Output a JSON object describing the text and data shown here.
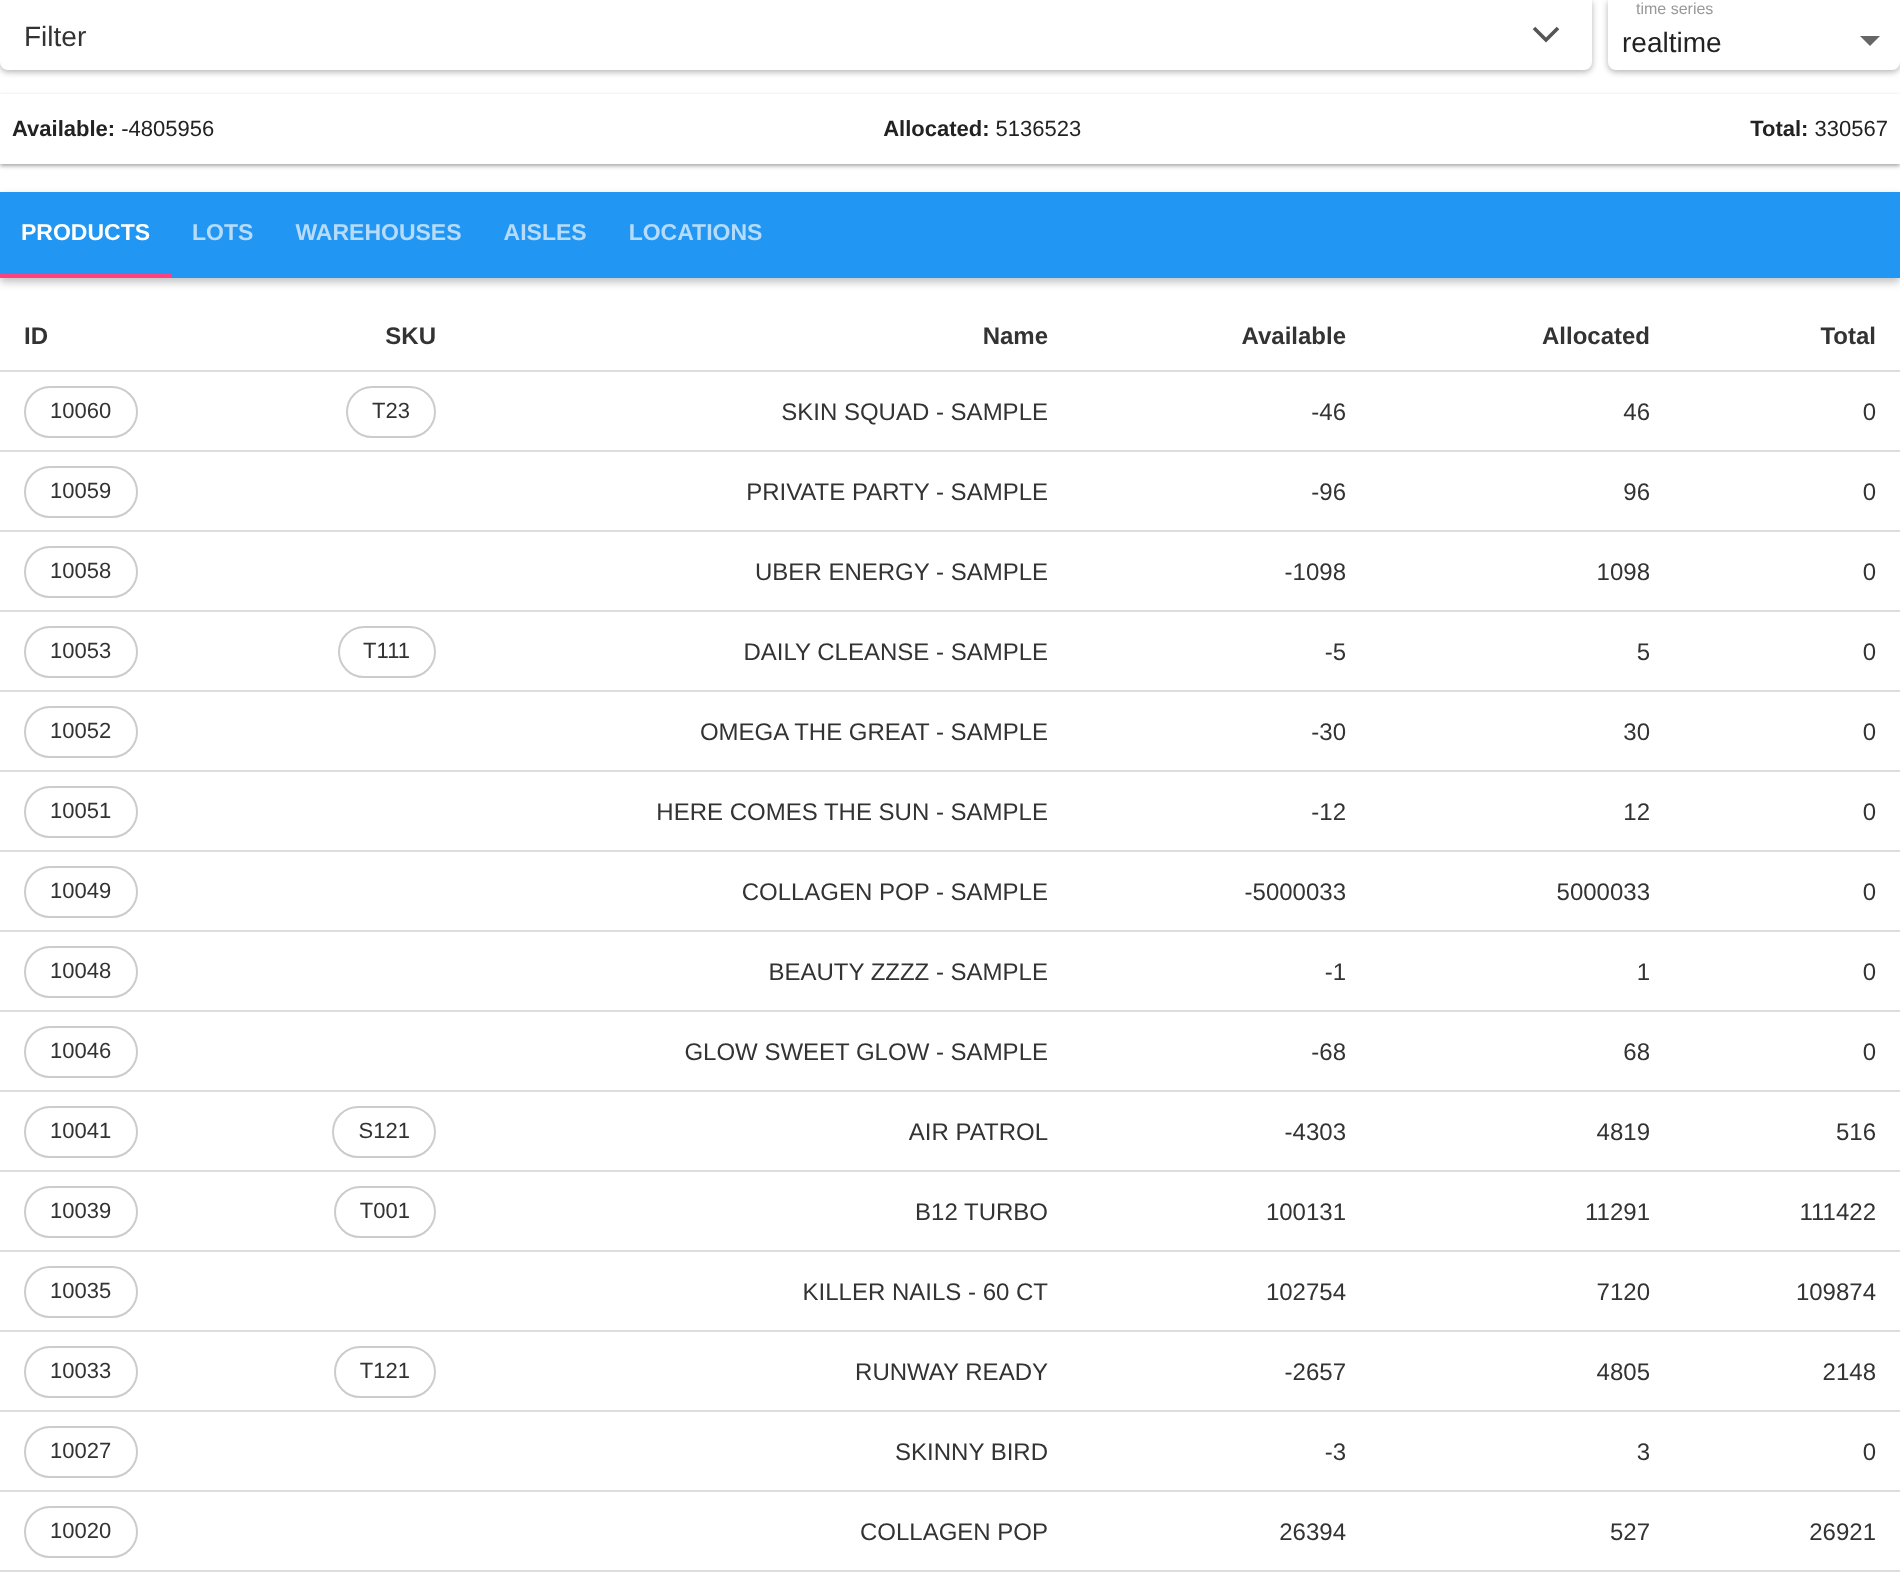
{
  "filter": {
    "placeholder": "Filter"
  },
  "time_series": {
    "label": "time series",
    "value": "realtime"
  },
  "summary": [
    {
      "label": "Available:",
      "value": "-4805956"
    },
    {
      "label": "Allocated:",
      "value": "5136523"
    },
    {
      "label": "Total:",
      "value": "330567"
    }
  ],
  "tabs": [
    {
      "label": "PRODUCTS",
      "selected": true
    },
    {
      "label": "LOTS",
      "selected": false
    },
    {
      "label": "WAREHOUSES",
      "selected": false
    },
    {
      "label": "AISLES",
      "selected": false
    },
    {
      "label": "LOCATIONS",
      "selected": false
    }
  ],
  "table": {
    "columns": [
      "ID",
      "SKU",
      "Name",
      "Available",
      "Allocated",
      "Total"
    ],
    "rows": [
      {
        "id": "10060",
        "sku": "T23",
        "name": "SKIN SQUAD - SAMPLE",
        "available": "-46",
        "allocated": "46",
        "total": "0"
      },
      {
        "id": "10059",
        "name": "PRIVATE PARTY - SAMPLE",
        "available": "-96",
        "allocated": "96",
        "total": "0"
      },
      {
        "id": "10058",
        "name": "UBER ENERGY - SAMPLE",
        "available": "-1098",
        "allocated": "1098",
        "total": "0"
      },
      {
        "id": "10053",
        "sku": "T111",
        "name": "DAILY CLEANSE - SAMPLE",
        "available": "-5",
        "allocated": "5",
        "total": "0"
      },
      {
        "id": "10052",
        "name": "OMEGA THE GREAT - SAMPLE",
        "available": "-30",
        "allocated": "30",
        "total": "0"
      },
      {
        "id": "10051",
        "name": "HERE COMES THE SUN - SAMPLE",
        "available": "-12",
        "allocated": "12",
        "total": "0"
      },
      {
        "id": "10049",
        "name": "COLLAGEN POP - SAMPLE",
        "available": "-5000033",
        "allocated": "5000033",
        "total": "0"
      },
      {
        "id": "10048",
        "name": "BEAUTY ZZZZ - SAMPLE",
        "available": "-1",
        "allocated": "1",
        "total": "0"
      },
      {
        "id": "10046",
        "name": "GLOW SWEET GLOW - SAMPLE",
        "available": "-68",
        "allocated": "68",
        "total": "0"
      },
      {
        "id": "10041",
        "sku": "S121",
        "name": "AIR PATROL",
        "available": "-4303",
        "allocated": "4819",
        "total": "516"
      },
      {
        "id": "10039",
        "sku": "T001",
        "name": "B12 TURBO",
        "available": "100131",
        "allocated": "11291",
        "total": "111422"
      },
      {
        "id": "10035",
        "name": "KILLER NAILS - 60 CT",
        "available": "102754",
        "allocated": "7120",
        "total": "109874"
      },
      {
        "id": "10033",
        "sku": "T121",
        "name": "RUNWAY READY",
        "available": "-2657",
        "allocated": "4805",
        "total": "2148"
      },
      {
        "id": "10027",
        "name": "SKINNY BIRD",
        "available": "-3",
        "allocated": "3",
        "total": "0"
      },
      {
        "id": "10020",
        "name": "COLLAGEN POP",
        "available": "26394",
        "allocated": "527",
        "total": "26921"
      }
    ]
  }
}
